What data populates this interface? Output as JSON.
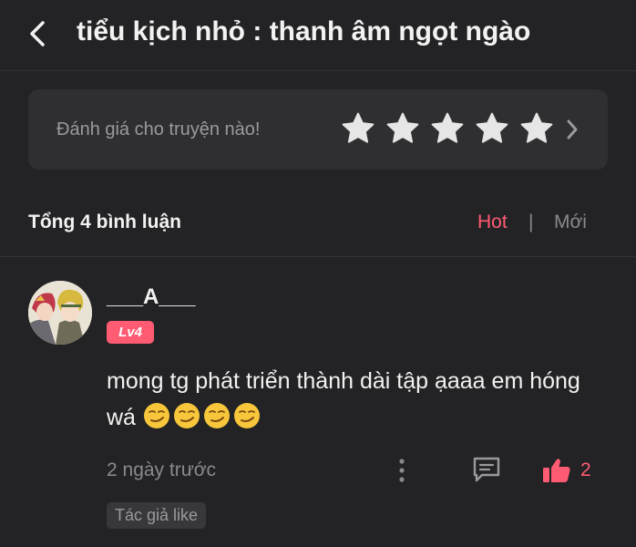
{
  "header": {
    "back_icon": "chevron-left-icon",
    "title": "tiểu kịch nhỏ : thanh âm ngọt ngào"
  },
  "rating": {
    "prompt": "Đánh giá cho truyện nào!",
    "star_icon": "star-icon",
    "star_count": 5,
    "star_color": "#e6e6e6",
    "chevron_icon": "chevron-right-icon"
  },
  "comments_summary": {
    "total": "Tổng 4 bình luận",
    "sort_hot": "Hot",
    "separator": "|",
    "sort_new": "Mới",
    "active_color": "#ff5b73"
  },
  "comment": {
    "username": "___A___",
    "level": "Lv4",
    "text": "mong tg phát triển thành dài tập ạaaa em hóng wá",
    "emojis": [
      "smirk-face-icon",
      "smirk-face-icon",
      "smirk-face-icon",
      "smirk-face-icon"
    ],
    "time": "2 ngày trước",
    "like_count": "2",
    "author_tag": "Tác giả like"
  },
  "colors": {
    "background": "#232325",
    "card": "#2f2f32",
    "accent": "#ff5b73",
    "muted_text": "#8a8a8e"
  }
}
